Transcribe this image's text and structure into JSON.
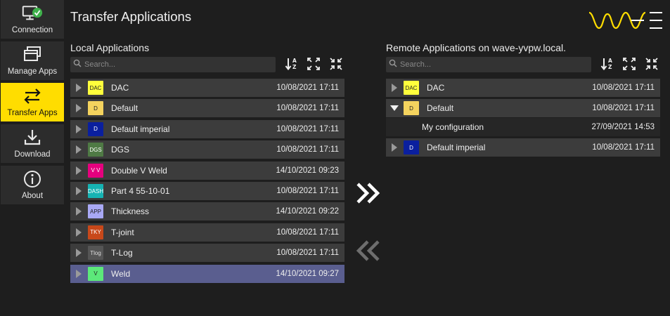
{
  "sidebar": {
    "items": [
      {
        "label": "Connection",
        "icon": "monitor-check-icon",
        "active": false
      },
      {
        "label": "Manage Apps",
        "icon": "stacked-windows-icon",
        "active": false
      },
      {
        "label": "Transfer Apps",
        "icon": "transfer-arrows-icon",
        "active": true
      },
      {
        "label": "Download",
        "icon": "download-icon",
        "active": false
      },
      {
        "label": "About",
        "icon": "info-icon",
        "active": false
      }
    ]
  },
  "header": {
    "title": "Transfer Applications",
    "logo_text": "WAVE"
  },
  "colors": {
    "accent": "#ffdd00",
    "selected_row": "#5a5e8f",
    "row": "#3c3c3c",
    "background": "#1e1e1e"
  },
  "local": {
    "title": "Local Applications",
    "search_placeholder": "Search...",
    "rows": [
      {
        "badge": "DAC",
        "badge_bg": "#ffff3c",
        "badge_fg": "#222",
        "name": "DAC",
        "date": "10/08/2021 17:11"
      },
      {
        "badge": "D",
        "badge_bg": "#f4d35e",
        "badge_fg": "#222",
        "name": "Default",
        "date": "10/08/2021 17:11"
      },
      {
        "badge": "D",
        "badge_bg": "#0a1f9e",
        "badge_fg": "#fff",
        "name": "Default imperial",
        "date": "10/08/2021 17:11"
      },
      {
        "badge": "DGS",
        "badge_bg": "#4f7a45",
        "badge_fg": "#fff",
        "name": "DGS",
        "date": "10/08/2021 17:11"
      },
      {
        "badge": "V V",
        "badge_bg": "#e6007e",
        "badge_fg": "#fff",
        "name": "Double V Weld",
        "date": "14/10/2021 09:23"
      },
      {
        "badge": "DASH",
        "badge_bg": "#16b3b3",
        "badge_fg": "#fff",
        "name": "Part 4 55-10-01",
        "date": "10/08/2021 17:11"
      },
      {
        "badge": "APP",
        "badge_bg": "#a9a9f5",
        "badge_fg": "#222",
        "name": "Thickness",
        "date": "14/10/2021 09:22"
      },
      {
        "badge": "TKY",
        "badge_bg": "#c8481a",
        "badge_fg": "#fff",
        "name": "T-joint",
        "date": "10/08/2021 17:11"
      },
      {
        "badge": "Tlog",
        "badge_bg": "#555",
        "badge_fg": "#ddd",
        "name": "T-Log",
        "date": "10/08/2021 17:11"
      },
      {
        "badge": "V",
        "badge_bg": "#5ce87a",
        "badge_fg": "#222",
        "name": "Weld",
        "date": "14/10/2021 09:27",
        "selected": true
      }
    ]
  },
  "remote": {
    "title": "Remote Applications on wave-yvpw.local.",
    "search_placeholder": "Search...",
    "rows": [
      {
        "badge": "DAC",
        "badge_bg": "#ffff3c",
        "badge_fg": "#222",
        "name": "DAC",
        "date": "10/08/2021 17:11",
        "expanded": false
      },
      {
        "badge": "D",
        "badge_bg": "#f4d35e",
        "badge_fg": "#222",
        "name": "Default",
        "date": "10/08/2021 17:11",
        "expanded": true,
        "children": [
          {
            "name": "My configuration",
            "date": "27/09/2021 14:53"
          }
        ]
      },
      {
        "badge": "D",
        "badge_bg": "#0a1f9e",
        "badge_fg": "#fff",
        "name": "Default imperial",
        "date": "10/08/2021 17:11",
        "expanded": false
      }
    ]
  },
  "transfer": {
    "to_remote_icon": "double-chevron-right-icon",
    "to_local_icon": "double-chevron-left-icon",
    "to_remote_enabled": true,
    "to_local_enabled": false
  }
}
